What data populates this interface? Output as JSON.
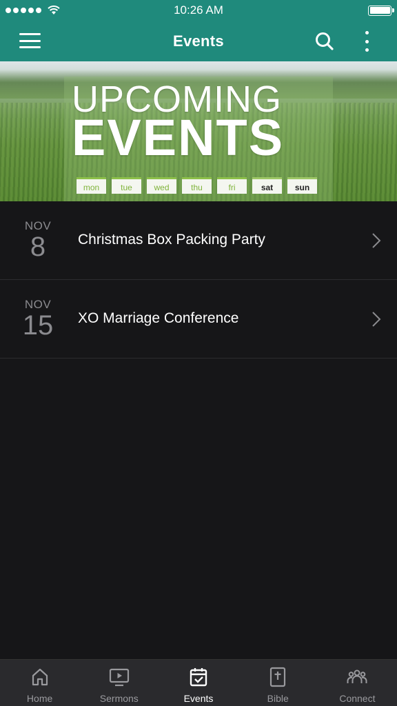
{
  "status_bar": {
    "time": "10:26 AM"
  },
  "app_bar": {
    "title": "Events"
  },
  "banner": {
    "line1": "UPCOMING",
    "line2": "EVENTS",
    "days": [
      "mon",
      "tue",
      "wed",
      "thu",
      "fri",
      "sat",
      "sun"
    ]
  },
  "events": [
    {
      "month": "NOV",
      "day": "8",
      "title": "Christmas Box Packing Party"
    },
    {
      "month": "NOV",
      "day": "15",
      "title": "XO Marriage Conference"
    }
  ],
  "tabs": [
    {
      "label": "Home",
      "icon": "home-icon",
      "active": false
    },
    {
      "label": "Sermons",
      "icon": "tv-play-icon",
      "active": false
    },
    {
      "label": "Events",
      "icon": "calendar-check-icon",
      "active": true
    },
    {
      "label": "Bible",
      "icon": "bible-icon",
      "active": false
    },
    {
      "label": "Connect",
      "icon": "group-icon",
      "active": false
    }
  ],
  "colors": {
    "app_bar": "#1f8a7c",
    "background": "#161618",
    "tab_bar": "#2a2a2d"
  }
}
